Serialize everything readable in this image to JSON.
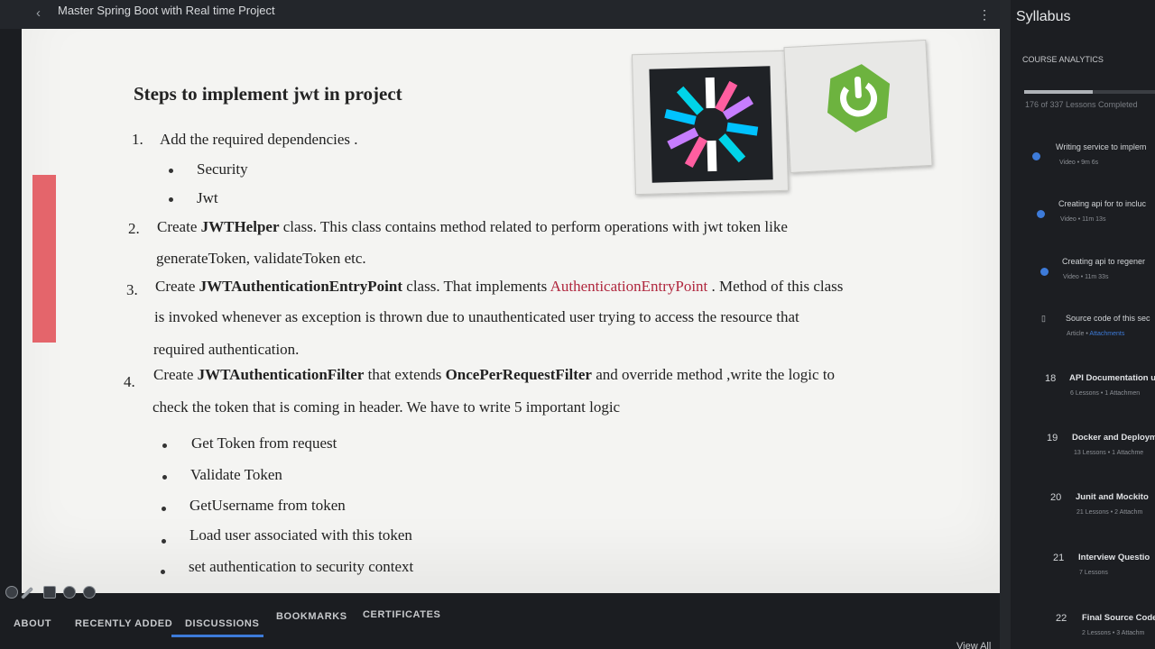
{
  "header": {
    "back_icon": "chevron-left-icon",
    "course_title": "Master Spring Boot with Real time Project",
    "more_icon": "kebab-menu-icon"
  },
  "slide": {
    "title": "Steps to implement jwt in project",
    "step1": {
      "num": "1.",
      "text": "Add the required dependencies .",
      "bullets": [
        "Security",
        "Jwt"
      ]
    },
    "step2": {
      "num": "2.",
      "pre": "Create ",
      "bold": "JWTHelper",
      "post": "  class. This class contains method related to perform operations with jwt token like",
      "line2": "generateToken, validateToken etc."
    },
    "step3": {
      "num": "3.",
      "pre": "Create ",
      "bold": "JWTAuthenticationEntryPoint",
      "mid": " class. That implements ",
      "red": "AuthenticationEntryPoint",
      "post": " . Method of this class",
      "line2": "is invoked whenever as exception is thrown due to unauthenticated user trying to access the resource that",
      "line3": "required authentication."
    },
    "step4": {
      "num": "4.",
      "pre": "Create ",
      "bold": "JWTAuthenticationFilter",
      "mid": " that extends ",
      "bold2": "OncePerRequestFilter",
      "post": " and override method ,write the logic to",
      "line2": "check the token that is coming in header. We have to write 5 important logic",
      "bullets": [
        "Get Token from request",
        "Validate Token",
        "GetUsername from token",
        "Load user associated with this token",
        "set authentication to security context"
      ]
    },
    "logos": {
      "jwt": "jwt-logo-icon",
      "spring": "spring-logo-icon"
    },
    "colors": {
      "red_text": "#b0273e",
      "spring_green": "#6db33f",
      "highlight": "#e4656b"
    }
  },
  "tabs": {
    "items": [
      "ABOUT",
      "RECENTLY ADDED",
      "DISCUSSIONS",
      "BOOKMARKS",
      "CERTIFICATES"
    ],
    "active": "DISCUSSIONS"
  },
  "view_all": "View All",
  "syllabus": {
    "title": "Syllabus",
    "analytics_label": "COURSE ANALYTICS",
    "progress_text": "176 of 337 Lessons Completed",
    "progress_fraction": 0.522,
    "lessons": [
      {
        "title": "Writing service to implem",
        "meta": "Video • 9m 6s",
        "icon": "check-circle-icon"
      },
      {
        "title": "Creating api for to incluc",
        "meta": "Video • 11m 13s",
        "icon": "check-circle-icon"
      },
      {
        "title": "Creating api to regener",
        "meta": "Video • 11m 33s",
        "icon": "check-circle-icon"
      },
      {
        "title": "Source code of this sec",
        "meta": "Article • ",
        "meta_link": "Attachments",
        "icon": "document-icon"
      }
    ],
    "sections": [
      {
        "num": "18",
        "title": "API Documentation u",
        "meta": "6 Lessons • 1 Attachmen"
      },
      {
        "num": "19",
        "title": "Docker and Deploym",
        "meta": "13 Lessons • 1 Attachme"
      },
      {
        "num": "20",
        "title": "Junit and Mockito",
        "meta": "21 Lessons • 2 Attachm"
      },
      {
        "num": "21",
        "title": "Interview Questio",
        "meta": "7 Lessons"
      },
      {
        "num": "22",
        "title": "Final Source Code",
        "meta": "2 Lessons • 3 Attachm"
      }
    ]
  }
}
